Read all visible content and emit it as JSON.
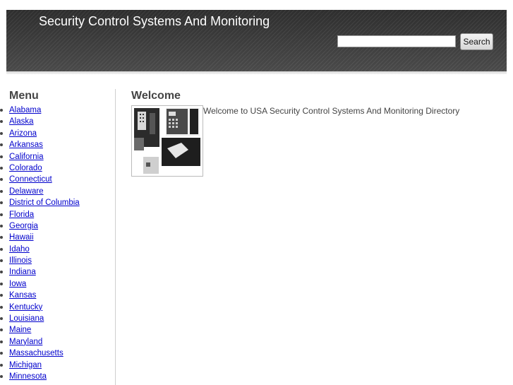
{
  "header": {
    "title": "Security Control Systems And Monitoring",
    "search_placeholder": "",
    "search_value": "",
    "search_button": "Search"
  },
  "sidebar": {
    "title": "Menu",
    "items": [
      "Alabama",
      "Alaska",
      "Arizona",
      "Arkansas",
      "California",
      "Colorado",
      "Connecticut",
      "Delaware",
      "District of Columbia",
      "Florida",
      "Georgia",
      "Hawaii",
      "Idaho",
      "Illinois",
      "Indiana",
      "Iowa",
      "Kansas",
      "Kentucky",
      "Louisiana",
      "Maine",
      "Maryland",
      "Massachusetts",
      "Michigan",
      "Minnesota"
    ]
  },
  "main": {
    "title": "Welcome",
    "text": "Welcome to USA Security Control Systems And Monitoring Directory"
  },
  "colors": {
    "header_bg": "#3a3a3a",
    "link": "#0000cc",
    "heading": "#444444"
  }
}
